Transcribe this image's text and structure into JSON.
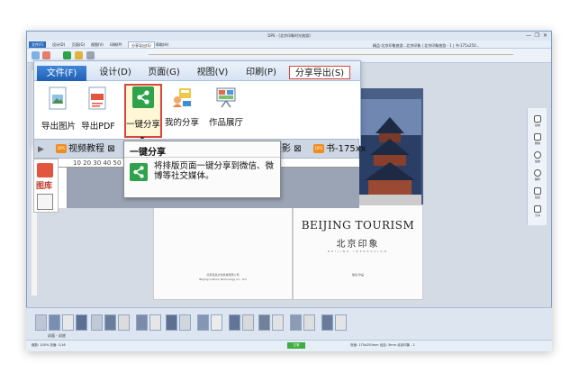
{
  "window": {
    "title": "DPS - [北京印象时光旅游]",
    "controls": [
      "—",
      "❐",
      "✕"
    ]
  },
  "small_menu": {
    "tabs": [
      "文件(F)",
      "设计(D)",
      "页面(G)",
      "视图(V)",
      "印刷(P)",
      "分享导出(S)",
      "帮助(H)"
    ]
  },
  "doc_tabs_right": "精品-北京印象旅游...北京印象 | 北京印象旅游 - 1 | 书-175x250...",
  "ribbon": {
    "tabs": [
      "文件(F)",
      "设计(D)",
      "页面(G)",
      "视图(V)",
      "印刷(P)",
      "分享导出(S)"
    ],
    "buttons": [
      "导出图片",
      "导出PDF",
      "一键分享",
      "我的分享",
      "作品展厅"
    ]
  },
  "doc_tabs": {
    "tab1": "视频教程",
    "tab2": "作库：旅游摄影",
    "tab3": "书-175xx",
    "close": "⊠"
  },
  "left_panel": {
    "label": "图库"
  },
  "zoom_ruler_numbers": "10  20  30  40  50  60  70  80  90  100  110  120  130",
  "tooltip": {
    "title": "一键分享",
    "text": "将排版页面一键分享到微信、微博等社交媒体。"
  },
  "book": {
    "title": "BEIJING TOURISM",
    "subtitle_cn": "北京印象",
    "subtitle_small": "BEIJING IMPRESSION",
    "publisher_left": "北京某某文化科技有限公司",
    "publisher_left2": "Beijing Culture Technology Co., Ltd",
    "publisher_right": "策划  作品"
  },
  "right_panel": {
    "items": [
      "复制",
      "删除",
      "缩放",
      "翻转",
      "链接",
      "分享"
    ]
  },
  "thumbstrip": {
    "label": "封面 - 封底"
  },
  "status": {
    "left": "缩放: 100%  页面: 1/16",
    "green": "正常",
    "right": "页面: 175x250mm  出血: 3mm  北京印象 - 1"
  },
  "colors": {
    "accent_blue": "#2f6cc0",
    "highlight_red": "#d9463f",
    "share_green": "#2fa34b",
    "dps_orange": "#f08c1e"
  }
}
